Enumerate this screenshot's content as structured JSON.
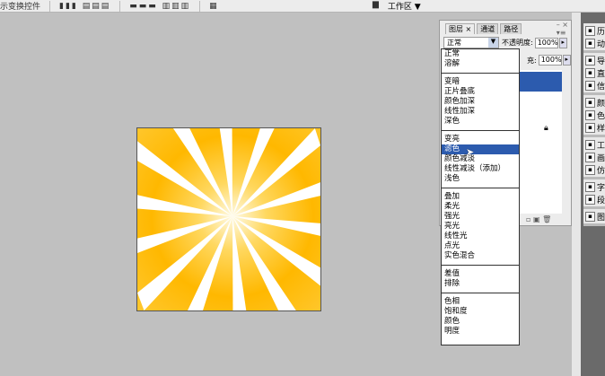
{
  "options_bar": {
    "transform_label": "示变换控件",
    "workspace_label": "工作区 ▼"
  },
  "layers_panel": {
    "tabs": [
      {
        "label": "图层 ×"
      },
      {
        "label": "通道"
      },
      {
        "label": "路径"
      }
    ],
    "blend_mode": "正常",
    "opacity_label": "不透明度:",
    "opacity_value": "100%",
    "fill_label": "充:",
    "fill_value": "100%"
  },
  "blend_menu": {
    "groups": [
      [
        "正常",
        "溶解"
      ],
      [
        "变暗",
        "正片叠底",
        "颜色加深",
        "线性加深",
        "深色"
      ],
      [
        "变亮",
        "滤色",
        "颜色减淡",
        "线性减淡（添加）",
        "浅色"
      ],
      [
        "叠加",
        "柔光",
        "强光",
        "亮光",
        "线性光",
        "点光",
        "实色混合"
      ],
      [
        "差值",
        "排除"
      ],
      [
        "色相",
        "饱和度",
        "颜色",
        "明度"
      ]
    ],
    "selected": "滤色"
  },
  "dock": {
    "groups": [
      [
        {
          "icon": "history-icon",
          "label": "历"
        },
        {
          "icon": "actions-icon",
          "label": "动"
        }
      ],
      [
        {
          "icon": "navigator-icon",
          "label": "导"
        },
        {
          "icon": "histogram-icon",
          "label": "直"
        },
        {
          "icon": "info-icon",
          "label": "信"
        }
      ],
      [
        {
          "icon": "color-icon",
          "label": "颜"
        },
        {
          "icon": "swatches-icon",
          "label": "色"
        },
        {
          "icon": "styles-icon",
          "label": "样"
        }
      ],
      [
        {
          "icon": "tool-presets-icon",
          "label": "工"
        },
        {
          "icon": "brushes-icon",
          "label": "画"
        },
        {
          "icon": "clone-source-icon",
          "label": "仿"
        }
      ],
      [
        {
          "icon": "character-icon",
          "label": "字"
        },
        {
          "icon": "paragraph-icon",
          "label": "段"
        }
      ],
      [
        {
          "icon": "layer-comps-icon",
          "label": "图"
        }
      ]
    ]
  },
  "colors": {
    "highlight": "#2c5bae",
    "ray_orange": "#ffb800",
    "ray_light": "#fff3c0"
  }
}
